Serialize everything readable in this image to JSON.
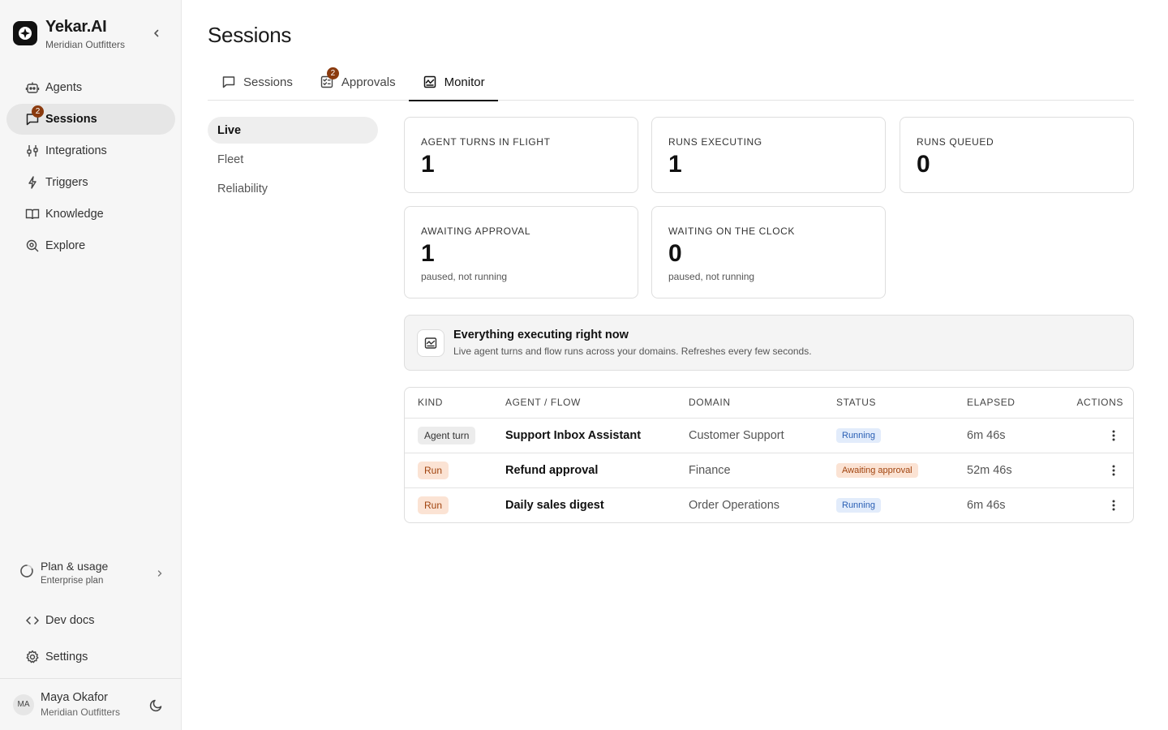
{
  "brand": {
    "name": "Yekar.AI",
    "org": "Meridian Outfitters"
  },
  "sidebar": {
    "items": [
      {
        "label": "Agents",
        "icon": "robot-icon"
      },
      {
        "label": "Sessions",
        "icon": "chat-icon",
        "badge": "2",
        "active": true
      },
      {
        "label": "Integrations",
        "icon": "integrations-icon"
      },
      {
        "label": "Triggers",
        "icon": "bolt-icon"
      },
      {
        "label": "Knowledge",
        "icon": "book-icon"
      },
      {
        "label": "Explore",
        "icon": "explore-icon"
      }
    ],
    "plan": {
      "title": "Plan & usage",
      "subtitle": "Enterprise plan"
    },
    "dev_docs": "Dev docs",
    "settings": "Settings",
    "user": {
      "initials": "MA",
      "name": "Maya Okafor",
      "org": "Meridian Outfitters"
    }
  },
  "main": {
    "title": "Sessions",
    "tabs": [
      {
        "label": "Sessions",
        "icon": "chat-icon"
      },
      {
        "label": "Approvals",
        "icon": "checklist-icon",
        "badge": "2"
      },
      {
        "label": "Monitor",
        "icon": "monitor-icon",
        "active": true
      }
    ],
    "subnav": [
      {
        "label": "Live",
        "active": true
      },
      {
        "label": "Fleet"
      },
      {
        "label": "Reliability"
      }
    ],
    "stats": [
      {
        "label": "Agent turns in flight",
        "value": "1",
        "note": ""
      },
      {
        "label": "Runs executing",
        "value": "1",
        "note": ""
      },
      {
        "label": "Runs queued",
        "value": "0",
        "note": ""
      },
      {
        "label": "Awaiting approval",
        "value": "1",
        "note": "paused, not running"
      },
      {
        "label": "Waiting on the clock",
        "value": "0",
        "note": "paused, not running"
      }
    ],
    "banner": {
      "title": "Everything executing right now",
      "subtitle": "Live agent turns and flow runs across your domains. Refreshes every few seconds."
    },
    "table": {
      "columns": [
        "Kind",
        "Agent / Flow",
        "Domain",
        "Status",
        "Elapsed",
        "Actions"
      ],
      "rows": [
        {
          "kind": "Agent turn",
          "kind_type": "agent",
          "name": "Support Inbox Assistant",
          "domain": "Customer Support",
          "status": "Running",
          "status_type": "running",
          "elapsed": "6m 46s"
        },
        {
          "kind": "Run",
          "kind_type": "run",
          "name": "Refund approval",
          "domain": "Finance",
          "status": "Awaiting approval",
          "status_type": "awaiting",
          "elapsed": "52m 46s"
        },
        {
          "kind": "Run",
          "kind_type": "run",
          "name": "Daily sales digest",
          "domain": "Order Operations",
          "status": "Running",
          "status_type": "running",
          "elapsed": "6m 46s"
        }
      ]
    }
  },
  "colors": {
    "accent_dark": "#111111",
    "badge": "#8a3a0e",
    "running_bg": "#e2ecfb",
    "awaiting_bg": "#fbe3d4"
  }
}
